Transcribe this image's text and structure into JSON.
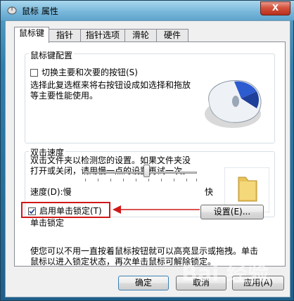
{
  "window": {
    "title": "鼠标 属性",
    "close": "X"
  },
  "tabs": [
    "鼠标键",
    "指针",
    "指针选项",
    "滑轮",
    "硬件"
  ],
  "buttons_config": {
    "legend": "鼠标键配置",
    "swap_label": "切换主要和次要的按钮(S)",
    "description": [
      "选择此复选框来将右按钮设成如选择和拖放",
      "等主要性能使用。"
    ]
  },
  "double_click": {
    "legend": "双击速度",
    "description": [
      "双击文件夹以检测您的设置。如果文件夹没",
      "打开或关闭，请用慢一点的设置再试一次。"
    ],
    "speed_label": "速度(D):慢",
    "fast_label": "快",
    "slider_value_fraction": 0.55
  },
  "click_lock": {
    "legend": "单击锁定",
    "enable_label": "启用单击锁定(T)",
    "checked": true,
    "settings_button": "设置(E)...",
    "description": [
      "使您可以不用一直按着鼠标按钮就可以高亮显示或拖拽。单击",
      "鼠标以进入锁定状态，再次单击鼠标可解除锁定。"
    ]
  },
  "footer": {
    "ok": "确定",
    "cancel": "取消",
    "apply": "应用(A)"
  },
  "colors": {
    "highlight_box": "#d01818",
    "window_frame": "#2f7fae"
  },
  "watermark": "Bai 经验"
}
